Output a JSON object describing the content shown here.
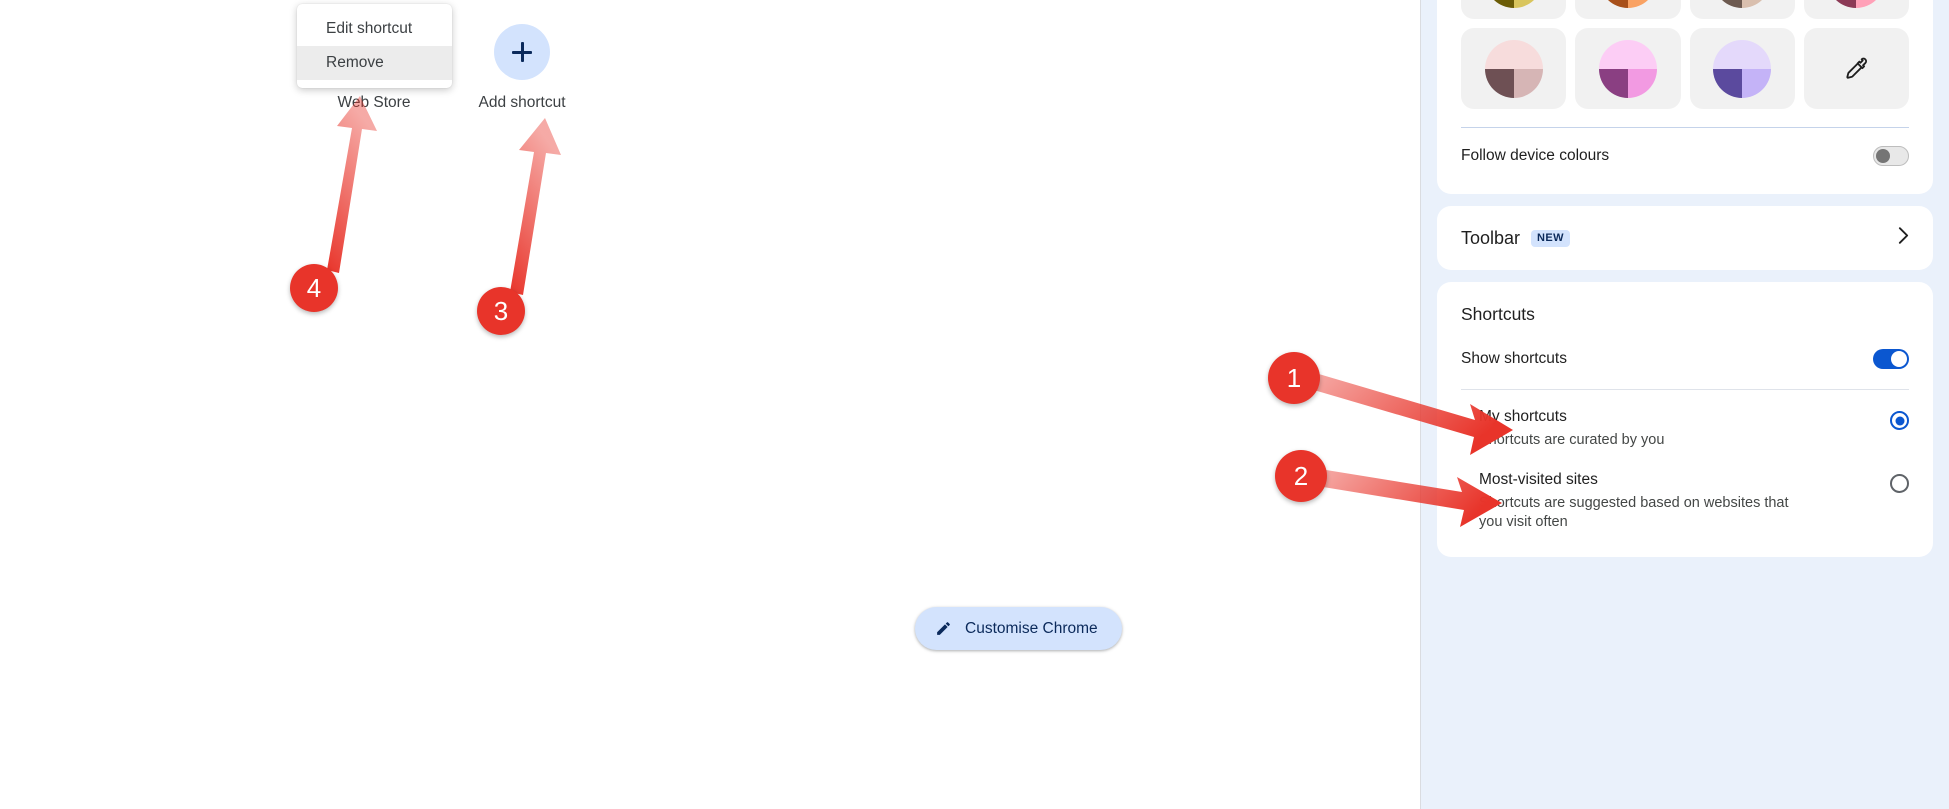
{
  "context_menu": {
    "items": [
      {
        "label": "Edit shortcut",
        "hovered": false
      },
      {
        "label": "Remove",
        "hovered": true
      }
    ]
  },
  "ntp": {
    "tiles": [
      {
        "name": "web-store",
        "label": "Web Store"
      },
      {
        "name": "add-shortcut",
        "label": "Add shortcut",
        "icon": "plus-icon"
      }
    ],
    "customise_button": {
      "label": "Customise Chrome",
      "icon": "pencil-icon"
    }
  },
  "panel": {
    "colours": {
      "swatches": [
        {
          "name": "yellow-olive",
          "top": "#f8e06f",
          "bottom_left": "#6b5c06",
          "bottom_right": "#d9c55d"
        },
        {
          "name": "peach-brown",
          "top": "#fcdcc4",
          "bottom_left": "#a8501a",
          "bottom_right": "#f9a263"
        },
        {
          "name": "beige-taupe",
          "top": "#fadcc9",
          "bottom_left": "#6d5a50",
          "bottom_right": "#d9bfae"
        },
        {
          "name": "pink-maroon",
          "top": "#fcd7e3",
          "bottom_left": "#8c3a56",
          "bottom_right": "#ffa1b8"
        },
        {
          "name": "blush-mauve",
          "top": "#f7dcdc",
          "bottom_left": "#6e5054",
          "bottom_right": "#d6b5b5"
        },
        {
          "name": "pink-purple",
          "top": "#fccdf5",
          "bottom_left": "#8a3f82",
          "bottom_right": "#f29ae2"
        },
        {
          "name": "lavender-violet",
          "top": "#e4d9fb",
          "bottom_left": "#5b4a9e",
          "bottom_right": "#c4b3f7"
        }
      ],
      "custom_colour_button": {
        "name": "eyedropper-icon",
        "label": ""
      }
    },
    "follow_device": {
      "label": "Follow device colours",
      "state": "off"
    },
    "toolbar": {
      "label": "Toolbar",
      "badge": "NEW",
      "chevron": "chevron-right-icon"
    },
    "shortcuts": {
      "title": "Shortcuts",
      "show_shortcuts": {
        "label": "Show shortcuts",
        "state": "on"
      },
      "options": [
        {
          "name": "my-shortcuts",
          "title": "My shortcuts",
          "desc": "Shortcuts are curated by you",
          "selected": true
        },
        {
          "name": "most-visited-sites",
          "title": "Most-visited sites",
          "desc": "Shortcuts are suggested based on websites that you visit often",
          "selected": false
        }
      ]
    }
  },
  "annotations": {
    "colour": "#e8342a",
    "markers": [
      {
        "id": "1",
        "label": "1"
      },
      {
        "id": "2",
        "label": "2"
      },
      {
        "id": "3",
        "label": "3"
      },
      {
        "id": "4",
        "label": "4"
      }
    ]
  }
}
